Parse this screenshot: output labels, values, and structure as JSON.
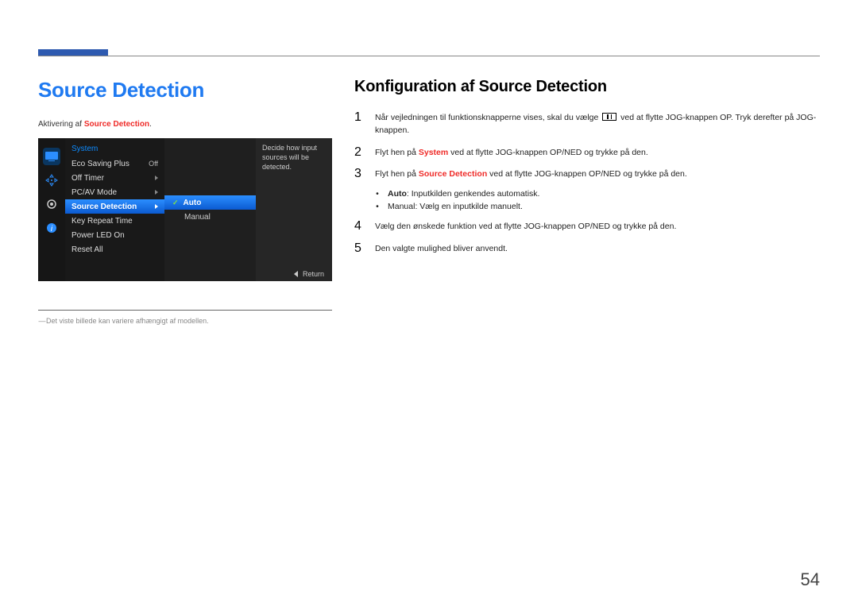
{
  "page_number": "54",
  "left": {
    "title": "Source Detection",
    "activation_prefix": "Aktivering af ",
    "activation_strong": "Source Detection",
    "activation_suffix": ".",
    "footnote": "Det viste billede kan variere afhængigt af modellen."
  },
  "osd": {
    "menu_title": "System",
    "items": [
      {
        "label": "Eco Saving Plus",
        "value": "Off"
      },
      {
        "label": "Off Timer",
        "value": ""
      },
      {
        "label": "PC/AV Mode",
        "value": ""
      },
      {
        "label": "Source Detection",
        "value": ""
      },
      {
        "label": "Key Repeat Time",
        "value": ""
      },
      {
        "label": "Power LED On",
        "value": ""
      },
      {
        "label": "Reset All",
        "value": ""
      }
    ],
    "options": [
      "Auto",
      "Manual"
    ],
    "hint": "Decide how input sources will be detected.",
    "return_label": "Return"
  },
  "right": {
    "heading": "Konfiguration af Source Detection",
    "steps": [
      {
        "num": "1",
        "pre": "Når vejledningen til funktionsknapperne vises, skal du vælge",
        "post": "ved at flytte JOG-knappen OP. Tryk derefter på JOG-knappen."
      },
      {
        "num": "2",
        "pre": "Flyt hen på ",
        "strong": "System",
        "post": " ved at flytte JOG-knappen OP/NED og trykke på den."
      },
      {
        "num": "3",
        "pre": "Flyt hen på ",
        "strong": "Source Detection",
        "post": " ved at flytte JOG-knappen OP/NED og trykke på den."
      },
      {
        "num": "4",
        "text": "Vælg den ønskede funktion ved at flytte JOG-knappen OP/NED og trykke på den."
      },
      {
        "num": "5",
        "text": "Den valgte mulighed bliver anvendt."
      }
    ],
    "options": [
      {
        "label": "Auto",
        "desc": ": Inputkilden genkendes automatisk."
      },
      {
        "label": "Manual",
        "desc": ": Vælg en inputkilde manuelt."
      }
    ]
  }
}
